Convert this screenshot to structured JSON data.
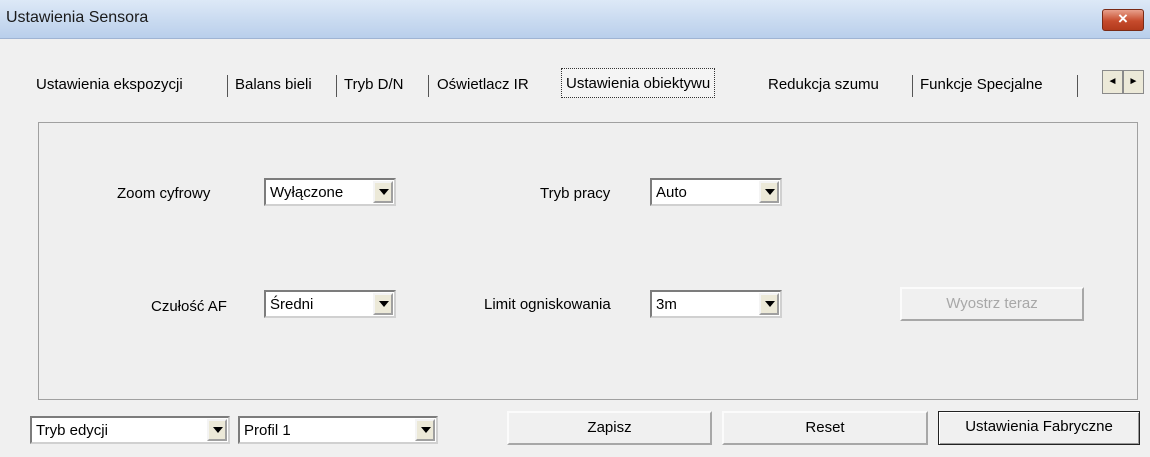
{
  "window": {
    "title": "Ustawienia Sensora",
    "close_symbol": "×"
  },
  "tabs": [
    {
      "label": "Ustawienia ekspozycji"
    },
    {
      "label": "Balans bieli"
    },
    {
      "label": "Tryb D/N"
    },
    {
      "label": "Oświetlacz IR"
    },
    {
      "label": "Ustawienia obiektywu",
      "active": true
    },
    {
      "label": "Redukcja szumu"
    },
    {
      "label": "Funkcje Specjalne"
    }
  ],
  "tab_scroll": {
    "left": "◄",
    "right": "►"
  },
  "lens_settings": {
    "digital_zoom": {
      "label": "Zoom cyfrowy",
      "value": "Wyłączone"
    },
    "mode": {
      "label": "Tryb pracy",
      "value": "Auto"
    },
    "af_sensitivity": {
      "label": "Czułość AF",
      "value": "Średni"
    },
    "focus_limit": {
      "label": "Limit ogniskowania",
      "value": "3m"
    },
    "focus_now_button": "Wyostrz teraz"
  },
  "footer": {
    "edit_mode": "Tryb edycji",
    "profile": "Profil 1",
    "save_button": "Zapisz",
    "reset_button": "Reset",
    "factory_button": "Ustawienia Fabryczne"
  }
}
